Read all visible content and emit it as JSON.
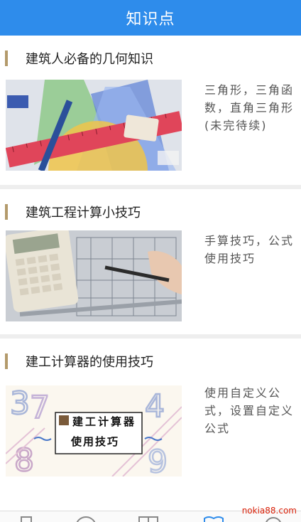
{
  "header": {
    "title": "知识点"
  },
  "cards": [
    {
      "title": "建筑人必备的几何知识",
      "desc": "三角形，三角函数，直角三角形(未完待续)"
    },
    {
      "title": "建筑工程计算小技巧",
      "desc": "手算技巧，公式使用技巧"
    },
    {
      "title": "建工计算器的使用技巧",
      "desc": "使用自定义公式，设置自定义公式",
      "image_text": {
        "line1": "建工计算器",
        "line2": "使用技巧"
      }
    }
  ],
  "tabbar": {
    "items": [
      "tab-1",
      "tab-2",
      "tab-3",
      "tab-4",
      "tab-5"
    ],
    "active_index": 3,
    "accent": "#2e8ceb"
  },
  "watermark": "nokia88.com"
}
